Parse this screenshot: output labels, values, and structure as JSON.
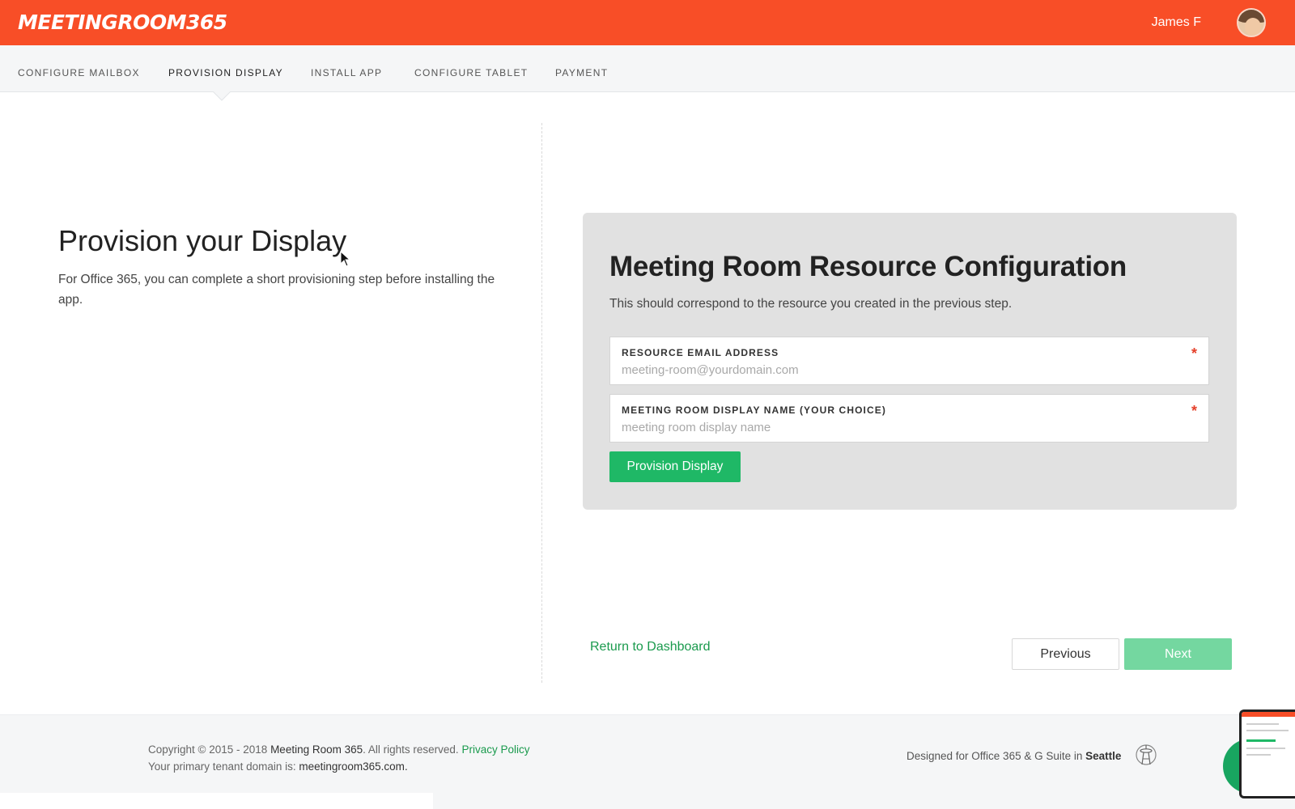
{
  "header": {
    "logo_text": "MEETINGROOM365",
    "user_name": "James F",
    "brand_color": "#f84e27"
  },
  "steps": {
    "items": [
      {
        "label": "CONFIGURE MAILBOX"
      },
      {
        "label": "PROVISION DISPLAY"
      },
      {
        "label": "INSTALL APP"
      },
      {
        "label": "CONFIGURE TABLET"
      },
      {
        "label": "PAYMENT"
      }
    ],
    "active": "PROVISION DISPLAY"
  },
  "intro": {
    "title": "Provision your Display",
    "description": "For Office 365, you can complete a short provisioning step before installing the app."
  },
  "config": {
    "title": "Meeting Room Resource Configuration",
    "subtitle": "This should correspond to the resource you created in the previous step.",
    "email_field": {
      "label": "RESOURCE EMAIL ADDRESS",
      "placeholder": "meeting-room@yourdomain.com",
      "value": "",
      "required_mark": "*"
    },
    "name_field": {
      "label": "MEETING ROOM DISPLAY NAME (YOUR CHOICE)",
      "placeholder": "meeting room display name",
      "value": "",
      "required_mark": "*"
    },
    "provision_button": "Provision Display"
  },
  "nav": {
    "return_link": "Return to Dashboard",
    "previous": "Previous",
    "next": "Next"
  },
  "footer": {
    "copyright_prefix": "Copyright © 2015 - 2018",
    "company": "Meeting Room 365",
    "rights": ". All rights reserved.",
    "privacy": "Privacy Policy",
    "tenant_prefix": "Your primary tenant domain is:",
    "tenant_domain": "meetingroom365.com",
    "tenant_suffix": ".",
    "designed_prefix": "Designed for Office 365 & G Suite in",
    "city": "Seattle"
  },
  "colors": {
    "accent_green": "#1fb866",
    "next_disabled_green": "#74d7a0",
    "link_green": "#1a9a4d",
    "required_red": "#e5402a"
  }
}
